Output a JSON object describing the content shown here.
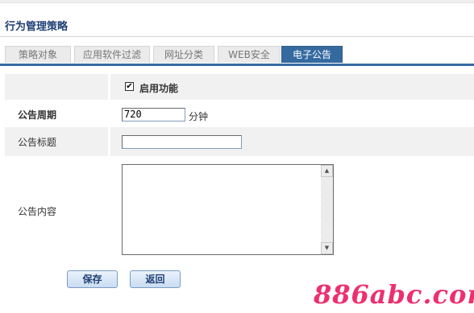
{
  "page": {
    "title": "行为管理策略"
  },
  "tabs": [
    {
      "label": "策略对象",
      "active": false
    },
    {
      "label": "应用软件过滤",
      "active": false
    },
    {
      "label": "网址分类",
      "active": false
    },
    {
      "label": "WEB安全",
      "active": false
    },
    {
      "label": "电子公告",
      "active": true
    }
  ],
  "form": {
    "enable": {
      "label": "启用功能",
      "checked": true,
      "check_mark": "✔"
    },
    "period": {
      "label": "公告周期",
      "value": "720",
      "unit": "分钟"
    },
    "subject": {
      "label": "公告标题",
      "value": ""
    },
    "content": {
      "label": "公告内容",
      "value": ""
    }
  },
  "buttons": {
    "save": "保存",
    "back": "返回"
  },
  "scrollbar": {
    "up": "▲",
    "down": "▼"
  },
  "watermark": "886abc.com",
  "colors": {
    "accent": "#356aa0",
    "title": "#1f3f74",
    "row_shade": "#f1f1f1",
    "watermark": "#ee2f6e"
  }
}
